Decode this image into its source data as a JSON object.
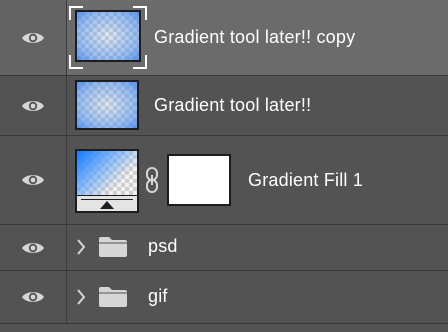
{
  "layers": [
    {
      "name": "Gradient tool later!! copy",
      "type": "layer",
      "selected": true,
      "visible": true,
      "eye_icon": "eye-icon",
      "thumb": "checker-blue-gradient"
    },
    {
      "name": "Gradient tool later!!",
      "type": "layer",
      "selected": false,
      "visible": true,
      "eye_icon": "eye-icon",
      "thumb": "checker-blue-gradient"
    },
    {
      "name": "Gradient Fill 1",
      "type": "fill",
      "selected": false,
      "visible": true,
      "eye_icon": "eye-icon",
      "thumb": "gradient-fill",
      "link_icon": "chain-link-icon",
      "mask": "white-mask"
    },
    {
      "name": "psd",
      "type": "group",
      "selected": false,
      "visible": true,
      "eye_icon": "eye-icon",
      "expand_icon": "chevron-right-icon",
      "folder_icon": "folder-icon"
    },
    {
      "name": "gif",
      "type": "group",
      "selected": false,
      "visible": true,
      "eye_icon": "eye-icon",
      "expand_icon": "chevron-right-icon",
      "folder_icon": "folder-icon"
    }
  ],
  "colors": {
    "panel_bg": "#535353",
    "selected_bg": "#6b6b6b",
    "text": "#ffffff",
    "divider": "#3a3a3a",
    "gradient_blue": "#1478ff"
  }
}
